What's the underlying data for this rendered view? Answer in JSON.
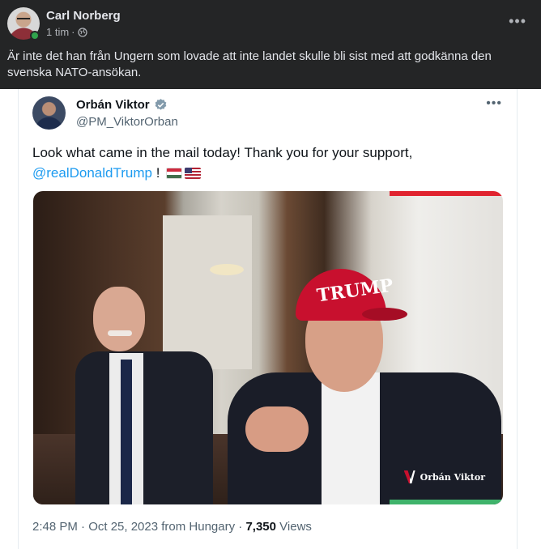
{
  "fb_post": {
    "author": "Carl Norberg",
    "time": "1 tim",
    "separator": "·",
    "privacy_icon": "globe-icon",
    "more_icon": "more-options-icon",
    "text": "Är inte det han från Ungern som lovade att inte landet skulle bli sist med att godkänna den svenska NATO-ansökan."
  },
  "tweet": {
    "display_name": "Orbán Viktor",
    "verified_icon": "verified-badge-icon",
    "handle": "@PM_ViktorOrban",
    "text_line1": "Look what came in the mail today! Thank you for your support,",
    "mention": "@realDonaldTrump",
    "text_after_mention": " !",
    "flags": [
      "hungary-flag-icon",
      "us-flag-icon"
    ],
    "photo": {
      "cap_text": "TRUMP",
      "logo_text": "Orbán Viktor"
    },
    "footer": {
      "time_date": "2:48 PM · Oct 25, 2023 from Hungary · ",
      "views_count": "7,350",
      "views_label": " Views"
    }
  },
  "colors": {
    "fb_background": "#242526",
    "fb_text": "#e4e6eb",
    "fb_secondary": "#b0b3b8",
    "online": "#31a24c",
    "twitter_blue": "#1d9bf0",
    "cap_red": "#c8102e"
  }
}
